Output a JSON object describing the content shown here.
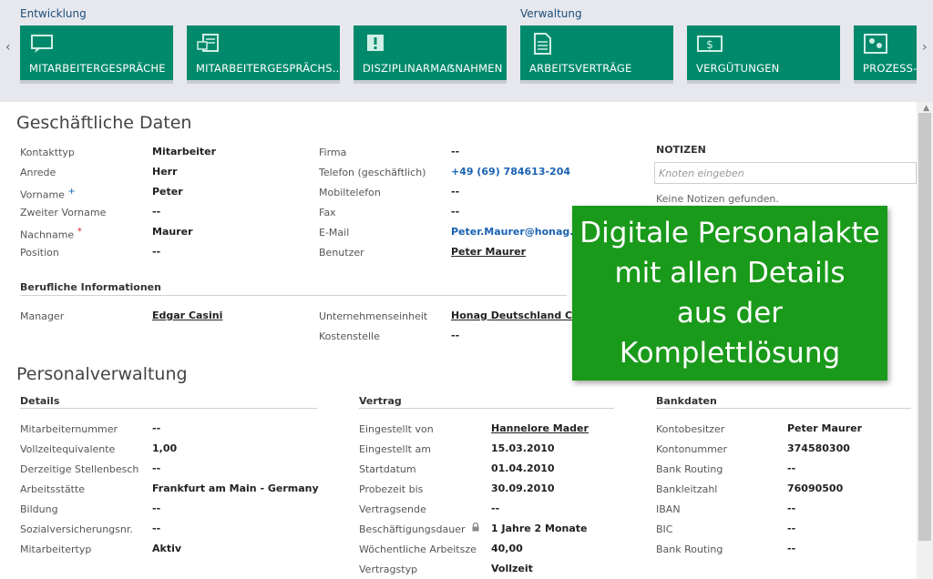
{
  "ribbon": {
    "group_dev": "Entwicklung",
    "group_admin": "Verwaltung",
    "prev_arrow": "‹",
    "next_arrow": "›",
    "tiles": [
      {
        "label": "MITARBEITERGESPRÄCHE",
        "icon": "speech-bubble-icon"
      },
      {
        "label": "MITARBEITERGESPRÄCHS...",
        "icon": "document-chat-icon"
      },
      {
        "label": "DISZIPLINARMAẞNAHMEN",
        "icon": "exclamation-icon"
      },
      {
        "label": "ARBEITSVERTRÄGE",
        "icon": "document-icon"
      },
      {
        "label": "VERGÜTUNGEN",
        "icon": "dollar-bill-icon"
      },
      {
        "label": "PROZESS-R",
        "icon": "process-icon"
      }
    ]
  },
  "business": {
    "title": "Geschäftliche Daten",
    "left": [
      {
        "label": "Kontakttyp",
        "value": "Mitarbeiter"
      },
      {
        "label": "Anrede",
        "value": "Herr"
      },
      {
        "label": "Vorname",
        "value": "Peter",
        "marker": "+"
      },
      {
        "label": "Zweiter Vorname",
        "value": "--"
      },
      {
        "label": "Nachname",
        "value": "Maurer",
        "marker": "*"
      },
      {
        "label": "Position",
        "value": "--"
      }
    ],
    "middle": [
      {
        "label": "Firma",
        "value": "--"
      },
      {
        "label": "Telefon (geschäftlich)",
        "value": "+49 (69) 784613-204"
      },
      {
        "label": "Mobiltelefon",
        "value": "--"
      },
      {
        "label": "Fax",
        "value": "--"
      },
      {
        "label": "E-Mail",
        "value": "Peter.Maurer@honag.com"
      },
      {
        "label": "Benutzer",
        "value": "Peter Maurer"
      }
    ],
    "professional_head": "Berufliche Informationen",
    "manager_label": "Manager",
    "manager_value": "Edgar Casini",
    "unit_label": "Unternehmenseinheit",
    "unit_value": "Honag Deutschland Consu",
    "cost_label": "Kostenstelle",
    "cost_value": "--"
  },
  "notes": {
    "title": "NOTIZEN",
    "placeholder": "Knoten eingeben",
    "empty": "Keine Notizen gefunden."
  },
  "personnel": {
    "title": "Personalverwaltung",
    "details_head": "Details",
    "details": [
      {
        "label": "Mitarbeiternummer",
        "value": "--"
      },
      {
        "label": "Vollzeitequivalente",
        "value": "1,00"
      },
      {
        "label": "Derzeitige Stellenbesch",
        "value": "--"
      },
      {
        "label": "Arbeitsstätte",
        "value": "Frankfurt am Main - Germany"
      },
      {
        "label": "Bildung",
        "value": "--"
      },
      {
        "label": "Sozialversicherungsnr.",
        "value": "--"
      },
      {
        "label": "Mitarbeitertyp",
        "value": "Aktiv"
      }
    ],
    "contract_head": "Vertrag",
    "contract": [
      {
        "label": "Eingestellt von",
        "value": "Hannelore Mader"
      },
      {
        "label": "Eingestellt am",
        "value": "15.03.2010"
      },
      {
        "label": "Startdatum",
        "value": "01.04.2010"
      },
      {
        "label": "Probezeit bis",
        "value": "30.09.2010"
      },
      {
        "label": "Vertragsende",
        "value": "--"
      },
      {
        "label": "Beschäftigungsdauer",
        "value": "1 Jahre 2 Monate"
      },
      {
        "label": "Wöchentliche Arbeitsze",
        "value": "40,00"
      },
      {
        "label": "Vertragstyp",
        "value": "Vollzeit"
      }
    ],
    "bank_head": "Bankdaten",
    "bank": [
      {
        "label": "Kontobesitzer",
        "value": "Peter Maurer"
      },
      {
        "label": "Kontonummer",
        "value": "374580300"
      },
      {
        "label": "Bank Routing",
        "value": "--"
      },
      {
        "label": "Bankleitzahl",
        "value": "76090500"
      },
      {
        "label": "IBAN",
        "value": "--"
      },
      {
        "label": "BIC",
        "value": "--"
      },
      {
        "label": "Bank Routing",
        "value": "--"
      }
    ]
  },
  "banner": {
    "lines": [
      "Digitale Personalakte",
      "mit allen Details",
      "aus der",
      "Komplettlösung"
    ],
    "color": "#1a9a1a"
  },
  "colors": {
    "tile": "#008a6b",
    "link": "#1a62b3"
  }
}
